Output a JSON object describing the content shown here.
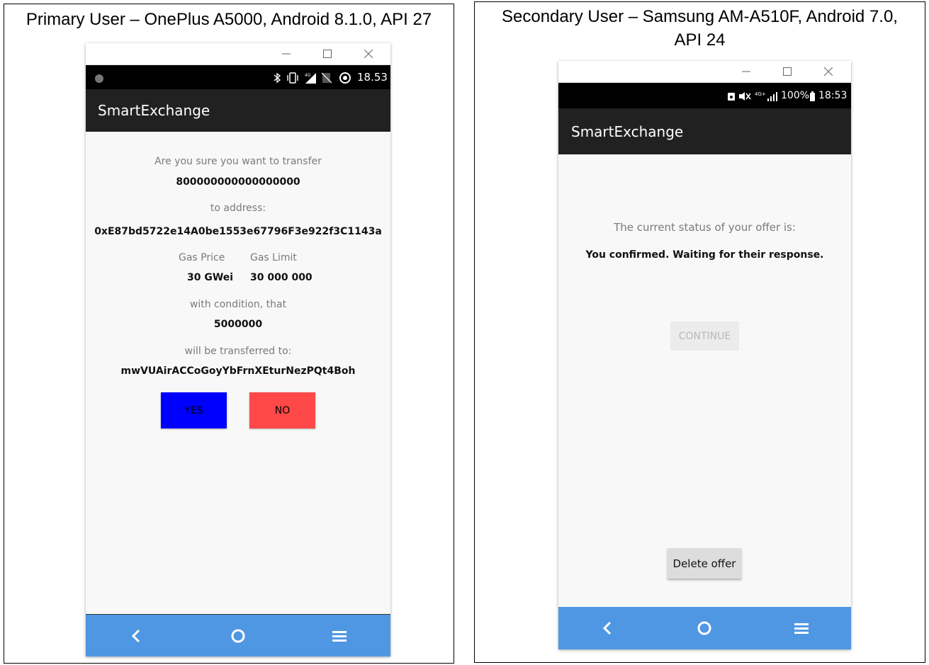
{
  "primary": {
    "caption": "Primary User – OnePlus A5000, Android 8.1.0, API 27",
    "status_time": "18.53",
    "status_icons": [
      "bluetooth-icon",
      "vibrate-icon",
      "signal-4g-icon",
      "no-sim-icon",
      "data-saver-icon"
    ],
    "app_title": "SmartExchange",
    "prompt": "Are you sure you want to transfer",
    "amount": "800000000000000000",
    "to_address_label": "to address:",
    "to_address": "0xE87bd5722e14A0be1553e67796F3e922f3C1143a",
    "gas_price_label": "Gas Price",
    "gas_limit_label": "Gas Limit",
    "gas_price": "30 GWei",
    "gas_limit": "30 000 000",
    "condition_label": "with condition, that",
    "condition_amount": "5000000",
    "transfer_to_label": "will be transferred to:",
    "transfer_to": "mwVUAirACCoGoyYbFrnXEturNezPQt4Boh",
    "yes_label": "YES",
    "no_label": "NO",
    "colors": {
      "yes": "#0000ff",
      "no": "#ff4848",
      "nav": "#4f97e3",
      "appbar": "#212121"
    }
  },
  "secondary": {
    "caption": "Secondary User – Samsung AM-A510F, Android 7.0, API 24",
    "status_time": "18:53",
    "battery": "100%",
    "status_icons": [
      "usb-icon",
      "mute-icon",
      "signal-4g-icon"
    ],
    "app_title": "SmartExchange",
    "status_label": "The current status of your offer is:",
    "status_value": "You confirmed. Waiting for their response.",
    "continue_label": "CONTINUE",
    "delete_label": "Delete offer"
  }
}
